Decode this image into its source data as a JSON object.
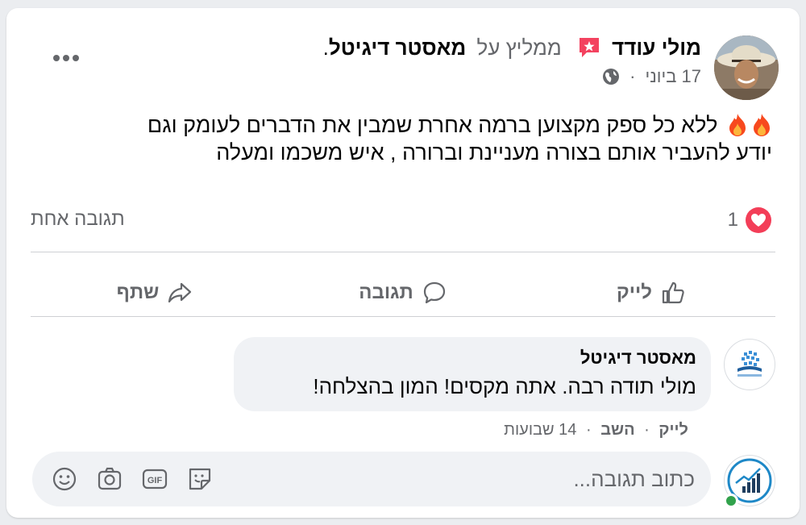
{
  "post": {
    "author": "מולי עודד",
    "recommends": "ממליץ על",
    "page_name": "מאסטר דיגיטל",
    "page_suffix": ".",
    "date": "17 ביוני",
    "meta_separator": "·",
    "text_line1": "ללא כל ספק מקצוען ברמה אחרת שמבין את הדברים לעומק וגם",
    "text_line2": "יודע להעביר אותם בצורה מעניינת וברורה , איש משכמו ומעלה",
    "emoji": [
      "fire-icon",
      "fire-icon"
    ]
  },
  "reactions": {
    "count": "1",
    "type": "heart-icon",
    "comment_count": "תגובה אחת"
  },
  "actions": {
    "like": "לייק",
    "comment": "תגובה",
    "share": "שתף"
  },
  "comment": {
    "author": "מאסטר דיגיטל",
    "text": "מולי תודה רבה. אתה מקסים! המון בהצלחה!",
    "like": "לייק",
    "reply": "השב",
    "time": "14 שבועות",
    "separator": "·"
  },
  "composer": {
    "placeholder": "כתוב תגובה...",
    "icons": [
      "emoji-icon",
      "camera-icon",
      "gif-icon",
      "sticker-icon"
    ]
  },
  "colors": {
    "heart": "#f33e58",
    "recommend_badge": "#f3425f",
    "secondary_text": "#65676b",
    "online": "#31a24c"
  }
}
